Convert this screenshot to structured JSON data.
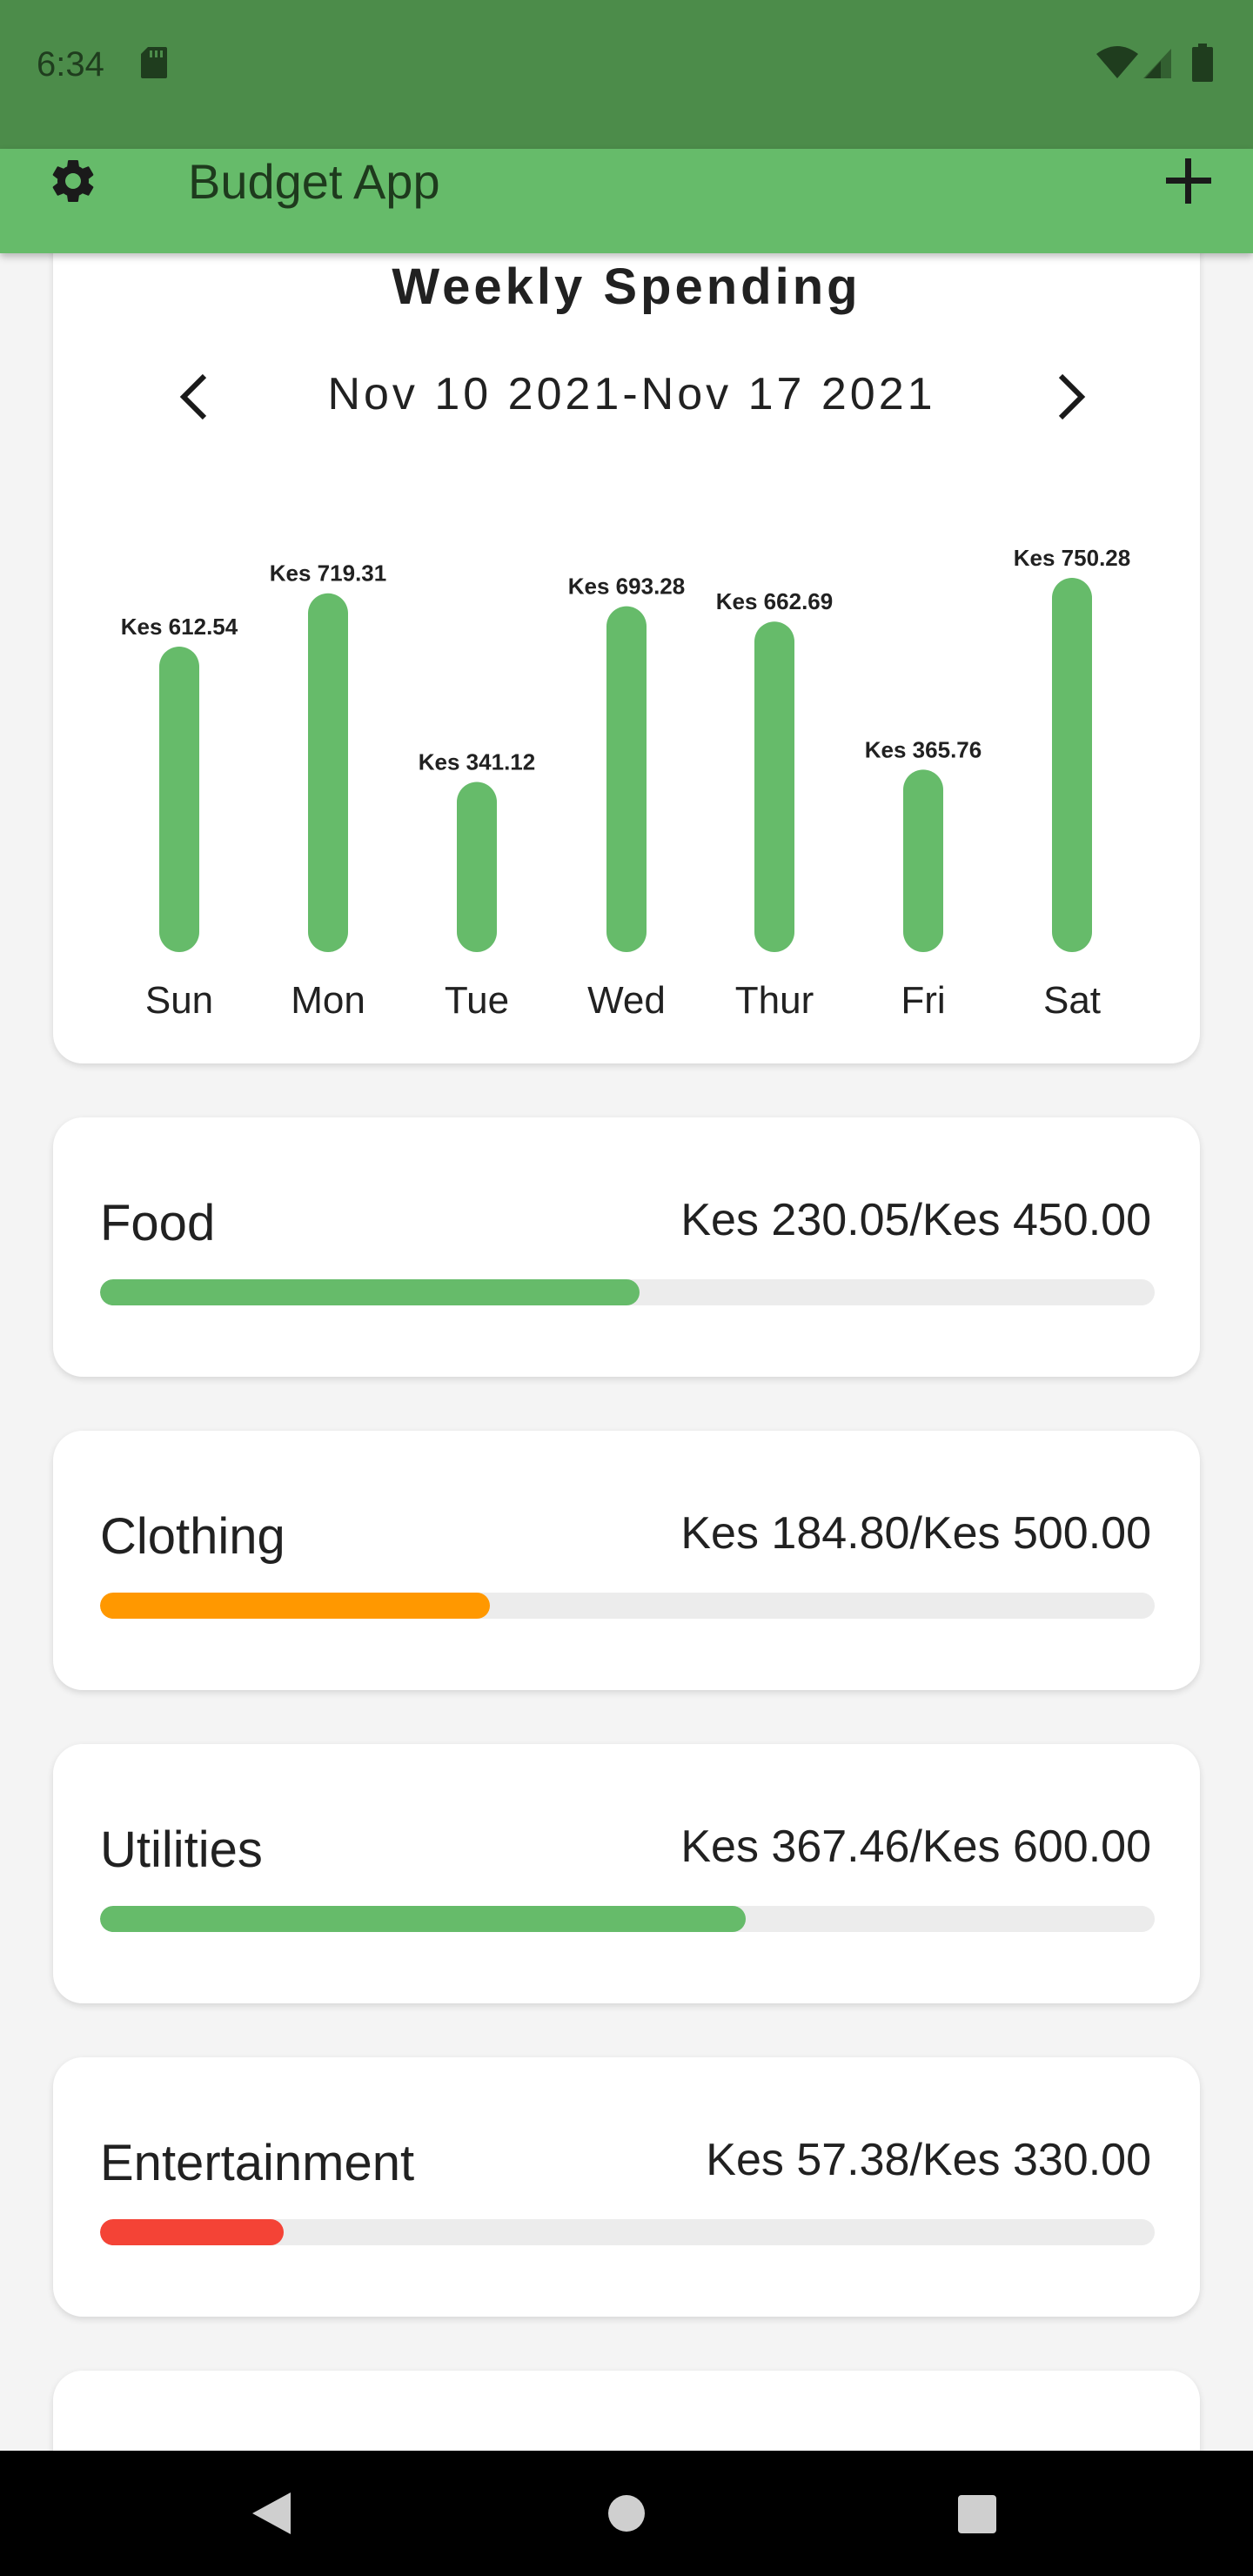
{
  "status_bar": {
    "time": "6:34",
    "icons": [
      "sd-card-icon",
      "wifi-icon",
      "signal-icon",
      "battery-icon"
    ]
  },
  "app_bar": {
    "title": "Budget App",
    "left_icon": "gear-icon",
    "right_icon": "plus-icon",
    "background_color": "#66bb6a"
  },
  "weekly_spending": {
    "title": "Weekly Spending",
    "date_range": "Nov 10 2021-Nov 17 2021",
    "prev_icon": "chevron-left-icon",
    "next_icon": "chevron-right-icon"
  },
  "chart_data": {
    "type": "bar",
    "categories": [
      "Sun",
      "Mon",
      "Tue",
      "Wed",
      "Thur",
      "Fri",
      "Sat"
    ],
    "values": [
      612.54,
      719.31,
      341.12,
      693.28,
      662.69,
      365.76,
      750.28
    ],
    "value_labels": [
      "Kes 612.54",
      "Kes 719.31",
      "Kes 341.12",
      "Kes 693.28",
      "Kes 662.69",
      "Kes 365.76",
      "Kes 750.28"
    ],
    "title": "Weekly Spending",
    "xlabel": "",
    "ylabel": "",
    "ylim": [
      0,
      750.28
    ],
    "grid": false,
    "bar_color": "#66bb6a"
  },
  "budgets": [
    {
      "name": "Food",
      "amount": "Kes 230.05/Kes 450.00",
      "spent": 230.05,
      "limit": 450.0,
      "color": "#66bb6a"
    },
    {
      "name": "Clothing",
      "amount": "Kes 184.80/Kes 500.00",
      "spent": 184.8,
      "limit": 500.0,
      "color": "#ff9800"
    },
    {
      "name": "Utilities",
      "amount": "Kes 367.46/Kes 600.00",
      "spent": 367.46,
      "limit": 600.0,
      "color": "#66bb6a"
    },
    {
      "name": "Entertainment",
      "amount": "Kes 57.38/Kes 330.00",
      "spent": 57.38,
      "limit": 330.0,
      "color": "#f44336"
    }
  ],
  "nav_bar": {
    "icons": [
      "back-icon",
      "home-icon",
      "recents-icon"
    ]
  }
}
